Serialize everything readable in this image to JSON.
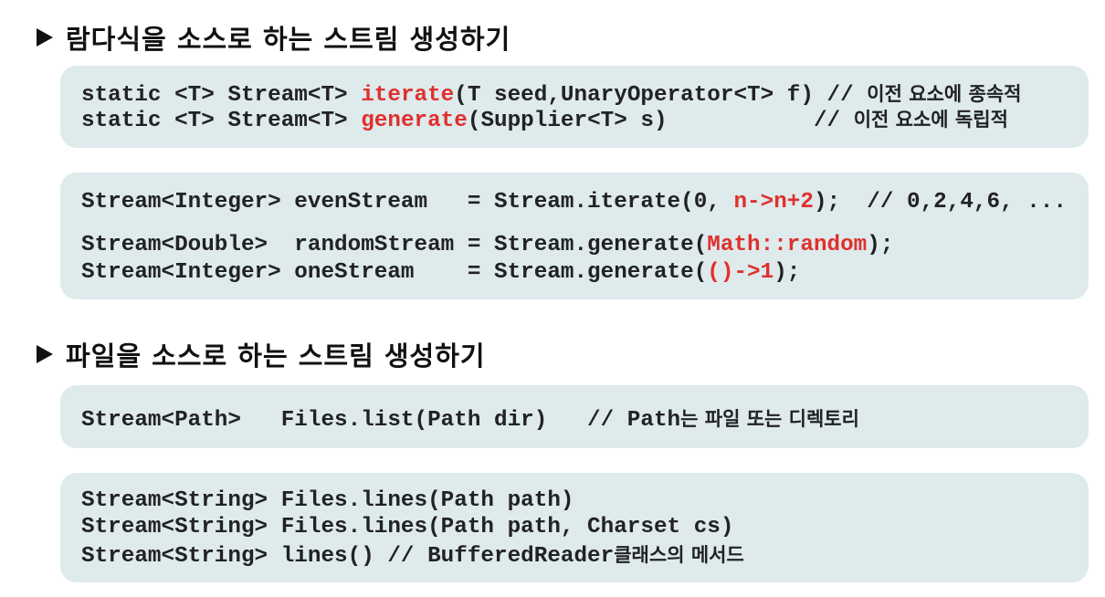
{
  "headings": [
    "람다식을 소스로 하는 스트림 생성하기",
    "파일을 소스로 하는 스트림 생성하기"
  ],
  "lines": [
    [
      [
        "static <T> Stream<T> ",
        ""
      ],
      [
        "iterate",
        "r"
      ],
      [
        "(T seed,UnaryOperator<T> f) // ",
        ""
      ],
      [
        "이전 요소에 종속적",
        "k"
      ]
    ],
    [
      [
        "static <T> Stream<T> ",
        ""
      ],
      [
        "generate",
        "r"
      ],
      [
        "(Supplier<T> s)           // ",
        ""
      ],
      [
        "이전 요소에 독립적",
        "k"
      ]
    ],
    [
      [
        "Stream<Integer> evenStream   = Stream.iterate(0, ",
        ""
      ],
      [
        "n->n+2",
        "r"
      ],
      [
        ");  // 0,2,4,6, ...",
        ""
      ]
    ],
    [
      [
        "Stream<Double>  randomStream = Stream.generate(",
        ""
      ],
      [
        "Math::random",
        "r"
      ],
      [
        ");",
        ""
      ]
    ],
    [
      [
        "Stream<Integer> oneStream    = Stream.generate(",
        ""
      ],
      [
        "()->1",
        "r"
      ],
      [
        ");",
        ""
      ]
    ],
    [
      [
        "Stream<Path>   Files.list(Path dir)   // Path",
        ""
      ],
      [
        "는 파일 또는 디렉토리",
        "k"
      ]
    ],
    [
      [
        "Stream<String> Files.lines(Path path)",
        ""
      ]
    ],
    [
      [
        "Stream<String> Files.lines(Path path, Charset cs)",
        ""
      ]
    ],
    [
      [
        "Stream<String> lines() // BufferedReader",
        ""
      ],
      [
        "클래스의 메서드",
        "k"
      ]
    ]
  ],
  "colors": {
    "box": "#deeaec",
    "highlight": "#e0302e",
    "text": "#222222"
  }
}
